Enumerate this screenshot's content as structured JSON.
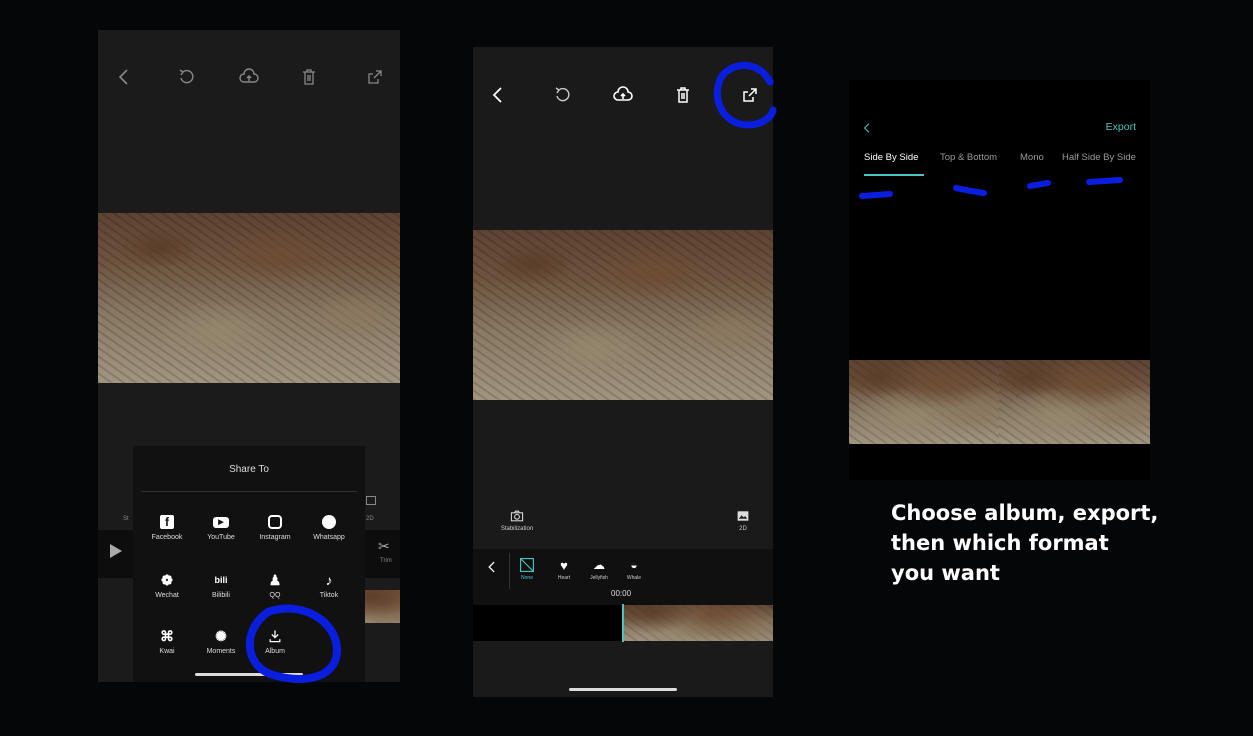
{
  "phone1": {
    "share": {
      "title": "Share To",
      "items": [
        {
          "label": "Facebook",
          "icon": "facebook-icon",
          "glyph": "f"
        },
        {
          "label": "YouTube",
          "icon": "youtube-icon",
          "glyph": "▶"
        },
        {
          "label": "Instagram",
          "icon": "instagram-icon",
          "glyph": "◎"
        },
        {
          "label": "Whatsapp",
          "icon": "whatsapp-icon",
          "glyph": "✆"
        },
        {
          "label": "Wechat",
          "icon": "wechat-icon",
          "glyph": "❁"
        },
        {
          "label": "Bilibili",
          "icon": "bilibili-icon",
          "glyph": "bili"
        },
        {
          "label": "QQ",
          "icon": "qq-icon",
          "glyph": "♟"
        },
        {
          "label": "Tiktok",
          "icon": "tiktok-icon",
          "glyph": "♪"
        },
        {
          "label": "Kwai",
          "icon": "kwai-icon",
          "glyph": "⌘"
        },
        {
          "label": "Moments",
          "icon": "moments-icon",
          "glyph": "✺"
        },
        {
          "label": "Album",
          "icon": "download-icon",
          "glyph": "⤓"
        }
      ]
    },
    "side_left": "St",
    "side_right_top": "2D",
    "trim_label": "Trim"
  },
  "phone2": {
    "stabilization_label": "Stabilization",
    "mode_label": "2D",
    "effects": [
      {
        "label": "None",
        "icon": "none-icon"
      },
      {
        "label": "Heart",
        "icon": "heart-icon"
      },
      {
        "label": "Jellyfish",
        "icon": "jellyfish-icon"
      },
      {
        "label": "Whale",
        "icon": "whale-icon"
      }
    ],
    "time": "00:00"
  },
  "phone3": {
    "export_label": "Export",
    "tabs": [
      {
        "label": "Side By Side",
        "active": true
      },
      {
        "label": "Top & Bottom",
        "active": false
      },
      {
        "label": "Mono",
        "active": false
      },
      {
        "label": "Half Side By Side",
        "active": false
      }
    ]
  },
  "caption": {
    "line1": "Choose album, export,",
    "line2": "then which format",
    "line3": "you want"
  },
  "colors": {
    "accent_teal": "#4fc3c3",
    "annotation_blue": "#0a1ee0",
    "background": "#050608"
  }
}
